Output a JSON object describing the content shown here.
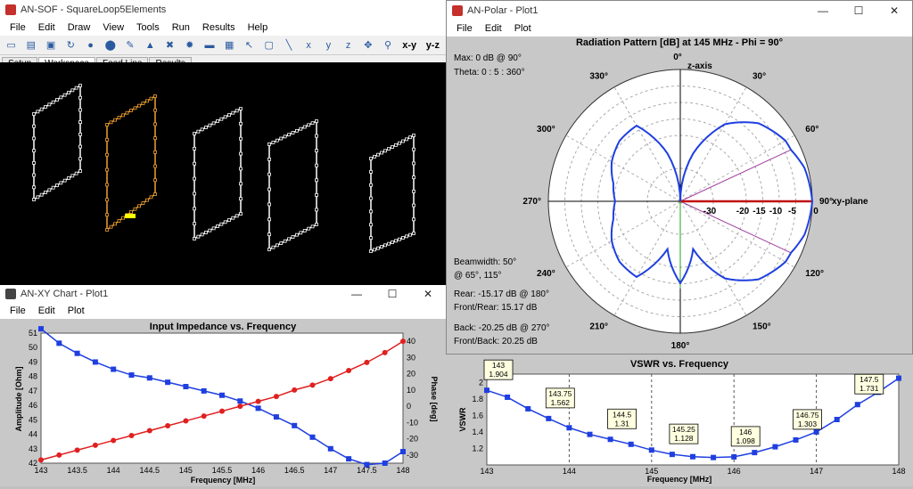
{
  "main_window": {
    "title": "AN-SOF - SquareLoop5Elements",
    "menu": [
      "File",
      "Edit",
      "Draw",
      "View",
      "Tools",
      "Run",
      "Results",
      "Help"
    ],
    "toolbar": [
      {
        "icon": "new-file-icon",
        "glyph": "▭"
      },
      {
        "icon": "open-folder-icon",
        "glyph": "▤"
      },
      {
        "icon": "save-icon",
        "glyph": "▣"
      },
      {
        "icon": "rotate-icon",
        "glyph": "↻"
      },
      {
        "icon": "circle-icon",
        "glyph": "●"
      },
      {
        "icon": "cylinder-icon",
        "glyph": "⬤"
      },
      {
        "icon": "pencil-icon",
        "glyph": "✎"
      },
      {
        "icon": "paint-icon",
        "glyph": "▲"
      },
      {
        "icon": "delete-icon",
        "glyph": "✖"
      },
      {
        "icon": "gear-icon",
        "glyph": "✹"
      },
      {
        "icon": "comment-icon",
        "glyph": "▬"
      },
      {
        "icon": "grid-icon",
        "glyph": "▦"
      },
      {
        "icon": "pointer-icon",
        "glyph": "↖"
      },
      {
        "icon": "select-rect-icon",
        "glyph": "▢"
      },
      {
        "icon": "line-icon",
        "glyph": "╲"
      },
      {
        "icon": "rotate-x-icon",
        "glyph": "x"
      },
      {
        "icon": "rotate-y-icon",
        "glyph": "y"
      },
      {
        "icon": "rotate-z-icon",
        "glyph": "z"
      },
      {
        "icon": "move-icon",
        "glyph": "✥"
      },
      {
        "icon": "zoom-icon",
        "glyph": "⚲"
      },
      {
        "icon": "view-xy-icon",
        "glyph": "x-y"
      },
      {
        "icon": "view-yz-icon",
        "glyph": "y-z"
      }
    ],
    "tabs": [
      "Setup",
      "Workspace",
      "Feed Line",
      "Results"
    ],
    "active_tab": "Workspace"
  },
  "xy_window": {
    "title": "AN-XY Chart - Plot1",
    "menu": [
      "File",
      "Edit",
      "Plot"
    ],
    "chart_data": {
      "type": "line",
      "title": "Input Impedance vs. Frequency",
      "xlabel": "Frequency [MHz]",
      "ylabel": "Amplitude [Ohm]",
      "y2label": "Phase [deg]",
      "xlim": [
        143,
        148
      ],
      "ylim": [
        42,
        51
      ],
      "y2lim": [
        -35,
        45
      ],
      "xticks": [
        "143",
        "143.5",
        "144",
        "144.5",
        "145",
        "145.5",
        "146",
        "146.5",
        "147",
        "147.5",
        "148"
      ],
      "yticks": [
        "42",
        "43",
        "44",
        "45",
        "46",
        "47",
        "48",
        "49",
        "50",
        "51"
      ],
      "y2ticks": [
        "-30",
        "-20",
        "-10",
        "0",
        "10",
        "20",
        "30",
        "40"
      ],
      "x": [
        143,
        143.25,
        143.5,
        143.75,
        144,
        144.25,
        144.5,
        144.75,
        145,
        145.25,
        145.5,
        145.75,
        146,
        146.25,
        146.5,
        146.75,
        147,
        147.25,
        147.5,
        147.75,
        148
      ],
      "series": [
        {
          "color": "#1f3fe0",
          "axis": "left",
          "values": [
            51.3,
            50.3,
            49.6,
            49.0,
            48.5,
            48.1,
            47.9,
            47.6,
            47.3,
            47.0,
            46.7,
            46.3,
            45.8,
            45.2,
            44.6,
            43.8,
            43.0,
            42.3,
            41.9,
            42.0,
            42.8
          ]
        },
        {
          "color": "#e02020",
          "axis": "right",
          "values": [
            -33,
            -30,
            -27,
            -24,
            -21,
            -18,
            -15,
            -12,
            -9,
            -6,
            -3,
            0,
            3,
            6,
            10,
            13,
            17,
            22,
            27,
            33,
            40
          ]
        }
      ]
    }
  },
  "polar_window": {
    "title": "AN-Polar - Plot1",
    "menu": [
      "File",
      "Edit",
      "Plot"
    ],
    "chart_data": {
      "type": "polar",
      "title": "Radiation Pattern [dB] at 145 MHz - Phi = 90°",
      "max_text": "Max: 0 dB @ 90°",
      "theta_text": "Theta: 0 : 5 : 360°",
      "beamwidth_text": "Beamwidth: 50°",
      "beamwidth_angles": "@ 65°, 115°",
      "rear_text": "Rear: -15.17 dB @ 180°",
      "front_rear_text": "Front/Rear: 15.17 dB",
      "back_text": "Back: -20.25 dB @ 270°",
      "front_back_text": "Front/Back: 20.25 dB",
      "axis_top": "z-axis",
      "axis_right": "xy-plane",
      "angle_labels": [
        "0°",
        "30°",
        "60°",
        "90°",
        "120°",
        "150°",
        "180°",
        "210°",
        "240°",
        "270°",
        "300°",
        "330°"
      ],
      "radial_labels": [
        "-30",
        "-20",
        "-15",
        "-10",
        "-5",
        "0"
      ],
      "radial_db": [
        -30,
        -20,
        -15,
        -10,
        -5,
        0
      ],
      "beam_angles": [
        65,
        115
      ],
      "pattern": {
        "theta": [
          0,
          15,
          30,
          45,
          60,
          65,
          75,
          90,
          105,
          115,
          120,
          135,
          150,
          165,
          180,
          195,
          210,
          225,
          240,
          255,
          270,
          285,
          300,
          315,
          330,
          345,
          360
        ],
        "db": [
          -40,
          -25,
          -13,
          -6.5,
          -3.2,
          -3,
          -1,
          0,
          -1,
          -3,
          -3.2,
          -6.5,
          -13,
          -25,
          -15.17,
          -25,
          -13.5,
          -14,
          -16,
          -19,
          -20.25,
          -19,
          -16,
          -14,
          -13.5,
          -25,
          -40
        ]
      }
    }
  },
  "vswr_window": {
    "chart_data": {
      "type": "line",
      "title": "VSWR vs. Frequency",
      "xlabel": "Frequency [MHz]",
      "ylabel": "VSWR",
      "xlim": [
        143,
        148
      ],
      "ylim": [
        1.0,
        2.1
      ],
      "xticks": [
        "143",
        "144",
        "145",
        "146",
        "147",
        "148"
      ],
      "yticks": [
        "1.2",
        "1.4",
        "1.6",
        "1.8",
        "2"
      ],
      "x": [
        143,
        143.25,
        143.5,
        143.75,
        144,
        144.25,
        144.5,
        144.75,
        145,
        145.25,
        145.5,
        145.75,
        146,
        146.25,
        146.5,
        146.75,
        147,
        147.25,
        147.5,
        147.75,
        148
      ],
      "values": [
        1.904,
        1.82,
        1.68,
        1.562,
        1.45,
        1.37,
        1.31,
        1.25,
        1.18,
        1.128,
        1.1,
        1.09,
        1.098,
        1.15,
        1.22,
        1.303,
        1.4,
        1.55,
        1.731,
        1.88,
        2.05
      ],
      "color": "#1f3fe0",
      "annotations": [
        {
          "x": 143,
          "y": 1.904,
          "f": "143",
          "v": "1.904"
        },
        {
          "x": 143.75,
          "y": 1.562,
          "f": "143.75",
          "v": "1.562"
        },
        {
          "x": 144.5,
          "y": 1.31,
          "f": "144.5",
          "v": "1.31"
        },
        {
          "x": 145.25,
          "y": 1.128,
          "f": "145.25",
          "v": "1.128"
        },
        {
          "x": 146,
          "y": 1.098,
          "f": "146",
          "v": "1.098"
        },
        {
          "x": 146.75,
          "y": 1.303,
          "f": "146.75",
          "v": "1.303"
        },
        {
          "x": 147.5,
          "y": 1.731,
          "f": "147.5",
          "v": "1.731"
        }
      ]
    }
  }
}
